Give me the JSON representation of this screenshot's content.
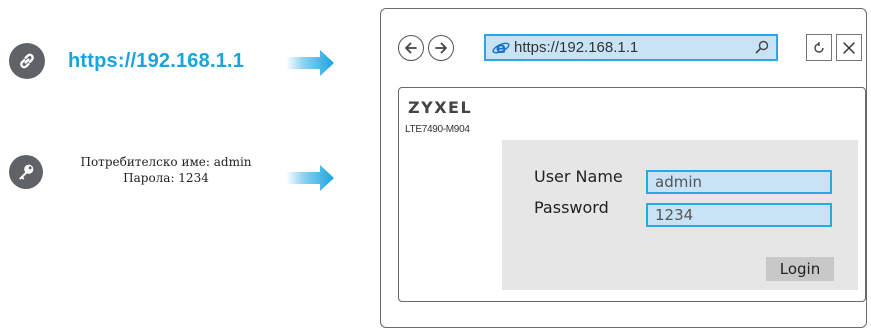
{
  "left_panel": {
    "url": "https://192.168.1.1",
    "credentials_line1": "Потребителско име: admin",
    "credentials_line2": "Парола: 1234",
    "link_icon": "link-icon",
    "key_icon": "key-icon"
  },
  "browser": {
    "address": "https://192.168.1.1",
    "nav_icons": [
      "back-arrow-icon",
      "forward-arrow-icon",
      "ie-logo-icon",
      "search-icon",
      "refresh-icon",
      "close-icon"
    ],
    "page": {
      "brand": "ZYXEL",
      "model": "LTE7490-M904",
      "username_label": "User Name",
      "username_value": "admin",
      "password_label": "Password",
      "password_value": "1234",
      "login_label": "Login"
    }
  },
  "colors": {
    "accent_blue": "#1aa4de",
    "field_fill": "#c7e3f5",
    "icon_gray": "#5f6368",
    "panel_gray": "#e6e6e6"
  }
}
